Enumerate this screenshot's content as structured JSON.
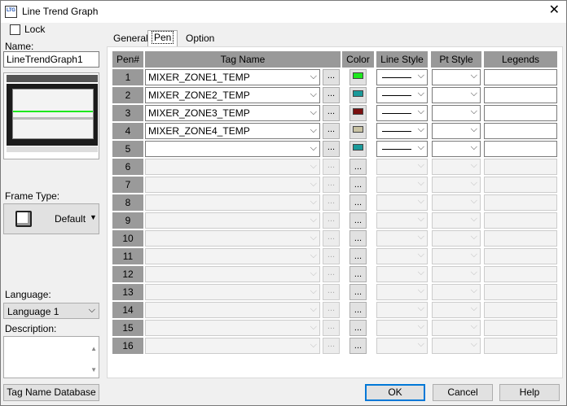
{
  "window": {
    "title": "Line Trend Graph",
    "close_glyph": "✕"
  },
  "left": {
    "lock_label": "Lock",
    "name_label": "Name:",
    "name_value": "LineTrendGraph1",
    "frame_type_label": "Frame Type:",
    "frame_type_value": "Default",
    "language_label": "Language:",
    "language_value": "Language 1",
    "description_label": "Description:",
    "tag_db_button": "Tag Name Database"
  },
  "tabs": [
    {
      "label": "General",
      "active": false
    },
    {
      "label": "Pen",
      "active": true
    },
    {
      "label": "Option",
      "active": false
    }
  ],
  "columns": {
    "pen": "Pen#",
    "tag": "Tag Name",
    "color": "Color",
    "line_style": "Line Style",
    "pt_style": "Pt Style",
    "legends": "Legends"
  },
  "rows": [
    {
      "num": "1",
      "tag": "MIXER_ZONE1_TEMP",
      "color": "#1ee81e",
      "enabled": true,
      "line": true
    },
    {
      "num": "2",
      "tag": "MIXER_ZONE2_TEMP",
      "color": "#1a9a9a",
      "enabled": true,
      "line": true
    },
    {
      "num": "3",
      "tag": "MIXER_ZONE3_TEMP",
      "color": "#7a1010",
      "enabled": true,
      "line": true
    },
    {
      "num": "4",
      "tag": "MIXER_ZONE4_TEMP",
      "color": "#c9c3a4",
      "enabled": true,
      "line": true
    },
    {
      "num": "5",
      "tag": "",
      "color": "#1a9a9a",
      "enabled": true,
      "line": true
    },
    {
      "num": "6",
      "tag": "",
      "color": null,
      "enabled": false,
      "line": false
    },
    {
      "num": "7",
      "tag": "",
      "color": null,
      "enabled": false,
      "line": false
    },
    {
      "num": "8",
      "tag": "",
      "color": null,
      "enabled": false,
      "line": false
    },
    {
      "num": "9",
      "tag": "",
      "color": null,
      "enabled": false,
      "line": false
    },
    {
      "num": "10",
      "tag": "",
      "color": null,
      "enabled": false,
      "line": false
    },
    {
      "num": "11",
      "tag": "",
      "color": null,
      "enabled": false,
      "line": false
    },
    {
      "num": "12",
      "tag": "",
      "color": null,
      "enabled": false,
      "line": false
    },
    {
      "num": "13",
      "tag": "",
      "color": null,
      "enabled": false,
      "line": false
    },
    {
      "num": "14",
      "tag": "",
      "color": null,
      "enabled": false,
      "line": false
    },
    {
      "num": "15",
      "tag": "",
      "color": null,
      "enabled": false,
      "line": false
    },
    {
      "num": "16",
      "tag": "",
      "color": null,
      "enabled": false,
      "line": false
    }
  ],
  "dots_label": "...",
  "buttons": {
    "ok": "OK",
    "cancel": "Cancel",
    "help": "Help"
  }
}
